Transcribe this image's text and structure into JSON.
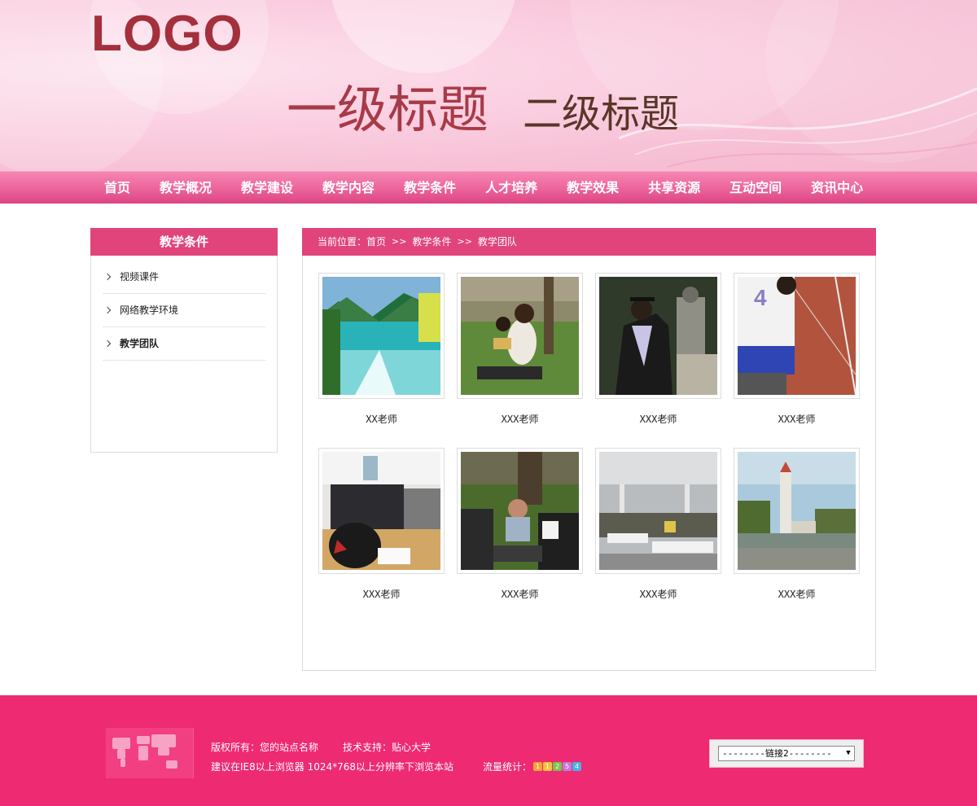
{
  "header": {
    "logo": "LOGO",
    "title_primary": "一级标题",
    "title_secondary": "二级标题"
  },
  "nav": {
    "items": [
      "首页",
      "教学概况",
      "教学建设",
      "教学内容",
      "教学条件",
      "人才培养",
      "教学效果",
      "共享资源",
      "互动空间",
      "资讯中心"
    ]
  },
  "sidebar": {
    "title": "教学条件",
    "items": [
      {
        "label": "视频课件",
        "active": false
      },
      {
        "label": "网络教学环境",
        "active": false
      },
      {
        "label": "教学团队",
        "active": true
      }
    ]
  },
  "breadcrumb": {
    "prefix": "当前位置：",
    "items": [
      "首页",
      "教学条件",
      "教学团队"
    ],
    "separator": ">>"
  },
  "teachers": [
    {
      "caption": "XX老师",
      "image": "lake"
    },
    {
      "caption": "XXX老师",
      "image": "students-reading"
    },
    {
      "caption": "XXX老师",
      "image": "graduate"
    },
    {
      "caption": "XXX老师",
      "image": "sprinter"
    },
    {
      "caption": "XXX老师",
      "image": "classroom"
    },
    {
      "caption": "XXX老师",
      "image": "lawn-group"
    },
    {
      "caption": "XXX老师",
      "image": "dining-hall"
    },
    {
      "caption": "XXX老师",
      "image": "campus-tower"
    }
  ],
  "footer": {
    "copyright": "版权所有：您的站点名称",
    "support": "技术支持：贴心大学",
    "browser_note": "建议在IE8以上浏览器 1024*768以上分辨率下浏览本站",
    "traffic_label": "流量统计：",
    "counter_digits": [
      "1",
      "1",
      "2",
      "5",
      "4"
    ],
    "link_select": "--------链接2--------"
  },
  "colors": {
    "accent": "#e0447a",
    "footer": "#ee2a72",
    "logo": "#a3303c"
  }
}
